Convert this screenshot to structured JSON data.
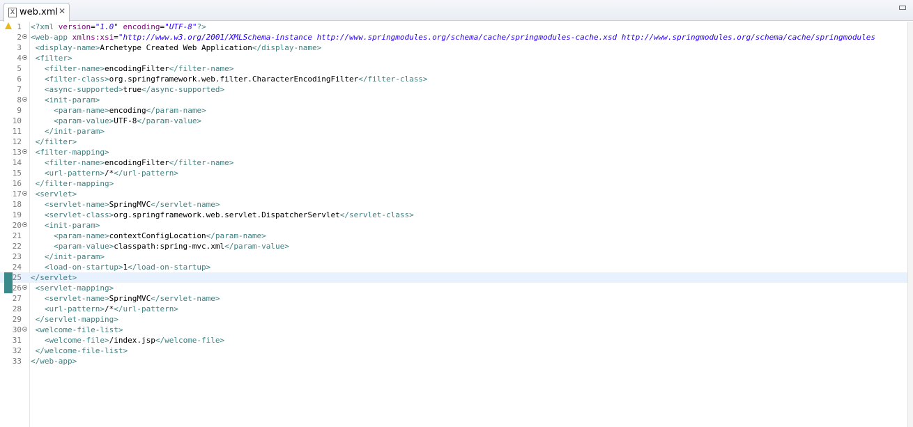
{
  "tab": {
    "label": "web.xml",
    "icon_glyph": "X"
  },
  "lines": [
    {
      "n": "1",
      "fold": false,
      "segs": [
        [
          "t",
          "<?xml "
        ],
        [
          "a",
          "version"
        ],
        [
          "",
          "="
        ],
        [
          "v",
          "\"1.0\""
        ],
        [
          "",
          " "
        ],
        [
          "a",
          "encoding"
        ],
        [
          "",
          "="
        ],
        [
          "v",
          "\"UTF-8\""
        ],
        [
          "t",
          "?>"
        ]
      ]
    },
    {
      "n": "2",
      "fold": true,
      "segs": [
        [
          "t",
          "<web-app "
        ],
        [
          "a",
          "xmlns:xsi"
        ],
        [
          "",
          "="
        ],
        [
          "v",
          "\"http://www.w3.org/2001/XMLSchema-instance http://www.springmodules.org/schema/cache/springmodules-cache.xsd http://www.springmodules.org/schema/cache/springmodules"
        ]
      ]
    },
    {
      "n": "3",
      "fold": false,
      "segs": [
        [
          "",
          " "
        ],
        [
          "t",
          "<display-name>"
        ],
        [
          "",
          "Archetype Created Web Application"
        ],
        [
          "t",
          "</display-name>"
        ]
      ]
    },
    {
      "n": "4",
      "fold": true,
      "segs": [
        [
          "",
          " "
        ],
        [
          "t",
          "<filter>"
        ]
      ]
    },
    {
      "n": "5",
      "fold": false,
      "segs": [
        [
          "",
          "   "
        ],
        [
          "t",
          "<filter-name>"
        ],
        [
          "",
          "encodingFilter"
        ],
        [
          "t",
          "</filter-name>"
        ]
      ]
    },
    {
      "n": "6",
      "fold": false,
      "segs": [
        [
          "",
          "   "
        ],
        [
          "t",
          "<filter-class>"
        ],
        [
          "",
          "org.springframework.web.filter.CharacterEncodingFilter"
        ],
        [
          "t",
          "</filter-class>"
        ]
      ]
    },
    {
      "n": "7",
      "fold": false,
      "segs": [
        [
          "",
          "   "
        ],
        [
          "t",
          "<async-supported>"
        ],
        [
          "",
          "true"
        ],
        [
          "t",
          "</async-supported>"
        ]
      ]
    },
    {
      "n": "8",
      "fold": true,
      "segs": [
        [
          "",
          "   "
        ],
        [
          "t",
          "<init-param>"
        ]
      ]
    },
    {
      "n": "9",
      "fold": false,
      "segs": [
        [
          "",
          "     "
        ],
        [
          "t",
          "<param-name>"
        ],
        [
          "",
          "encoding"
        ],
        [
          "t",
          "</param-name>"
        ]
      ]
    },
    {
      "n": "10",
      "fold": false,
      "segs": [
        [
          "",
          "     "
        ],
        [
          "t",
          "<param-value>"
        ],
        [
          "",
          "UTF-8"
        ],
        [
          "t",
          "</param-value>"
        ]
      ]
    },
    {
      "n": "11",
      "fold": false,
      "segs": [
        [
          "",
          "   "
        ],
        [
          "t",
          "</init-param>"
        ]
      ]
    },
    {
      "n": "12",
      "fold": false,
      "segs": [
        [
          "",
          " "
        ],
        [
          "t",
          "</filter>"
        ]
      ]
    },
    {
      "n": "13",
      "fold": true,
      "segs": [
        [
          "",
          " "
        ],
        [
          "t",
          "<filter-mapping>"
        ]
      ]
    },
    {
      "n": "14",
      "fold": false,
      "segs": [
        [
          "",
          "   "
        ],
        [
          "t",
          "<filter-name>"
        ],
        [
          "",
          "encodingFilter"
        ],
        [
          "t",
          "</filter-name>"
        ]
      ]
    },
    {
      "n": "15",
      "fold": false,
      "segs": [
        [
          "",
          "   "
        ],
        [
          "t",
          "<url-pattern>"
        ],
        [
          "",
          "/*"
        ],
        [
          "t",
          "</url-pattern>"
        ]
      ]
    },
    {
      "n": "16",
      "fold": false,
      "segs": [
        [
          "",
          " "
        ],
        [
          "t",
          "</filter-mapping>"
        ]
      ]
    },
    {
      "n": "17",
      "fold": true,
      "segs": [
        [
          "",
          " "
        ],
        [
          "t",
          "<servlet>"
        ]
      ]
    },
    {
      "n": "18",
      "fold": false,
      "segs": [
        [
          "",
          "   "
        ],
        [
          "t",
          "<servlet-name>"
        ],
        [
          "",
          "SpringMVC"
        ],
        [
          "t",
          "</servlet-name>"
        ]
      ]
    },
    {
      "n": "19",
      "fold": false,
      "segs": [
        [
          "",
          "   "
        ],
        [
          "t",
          "<servlet-class>"
        ],
        [
          "",
          "org.springframework.web.servlet.DispatcherServlet"
        ],
        [
          "t",
          "</servlet-class>"
        ]
      ]
    },
    {
      "n": "20",
      "fold": true,
      "segs": [
        [
          "",
          "   "
        ],
        [
          "t",
          "<init-param>"
        ]
      ]
    },
    {
      "n": "21",
      "fold": false,
      "segs": [
        [
          "",
          "     "
        ],
        [
          "t",
          "<param-name>"
        ],
        [
          "",
          "contextConfigLocation"
        ],
        [
          "t",
          "</param-name>"
        ]
      ]
    },
    {
      "n": "22",
      "fold": false,
      "segs": [
        [
          "",
          "     "
        ],
        [
          "t",
          "<param-value>"
        ],
        [
          "",
          "classpath:spring-mvc.xml"
        ],
        [
          "t",
          "</param-value>"
        ]
      ]
    },
    {
      "n": "23",
      "fold": false,
      "segs": [
        [
          "",
          "   "
        ],
        [
          "t",
          "</init-param>"
        ]
      ]
    },
    {
      "n": "24",
      "fold": false,
      "segs": [
        [
          "",
          "   "
        ],
        [
          "t",
          "<load-on-startup>"
        ],
        [
          "",
          "1"
        ],
        [
          "t",
          "</load-on-startup>"
        ]
      ]
    },
    {
      "n": "25",
      "fold": false,
      "current": true,
      "changed": true,
      "segs": [
        [
          "t",
          "</servlet>"
        ]
      ]
    },
    {
      "n": "26",
      "fold": true,
      "changed": true,
      "segs": [
        [
          "",
          " "
        ],
        [
          "t",
          "<servlet-mapping>"
        ]
      ]
    },
    {
      "n": "27",
      "fold": false,
      "segs": [
        [
          "",
          "   "
        ],
        [
          "t",
          "<servlet-name>"
        ],
        [
          "",
          "SpringMVC"
        ],
        [
          "t",
          "</servlet-name>"
        ]
      ]
    },
    {
      "n": "28",
      "fold": false,
      "segs": [
        [
          "",
          "   "
        ],
        [
          "t",
          "<url-pattern>"
        ],
        [
          "",
          "/*"
        ],
        [
          "t",
          "</url-pattern>"
        ]
      ]
    },
    {
      "n": "29",
      "fold": false,
      "segs": [
        [
          "",
          " "
        ],
        [
          "t",
          "</servlet-mapping>"
        ]
      ]
    },
    {
      "n": "30",
      "fold": true,
      "segs": [
        [
          "",
          " "
        ],
        [
          "t",
          "<welcome-file-list>"
        ]
      ]
    },
    {
      "n": "31",
      "fold": false,
      "segs": [
        [
          "",
          "   "
        ],
        [
          "t",
          "<welcome-file>"
        ],
        [
          "",
          "/index.jsp"
        ],
        [
          "t",
          "</welcome-file>"
        ]
      ]
    },
    {
      "n": "32",
      "fold": false,
      "segs": [
        [
          "",
          " "
        ],
        [
          "t",
          "</welcome-file-list>"
        ]
      ]
    },
    {
      "n": "33",
      "fold": false,
      "segs": [
        [
          "t",
          "</web-app>"
        ]
      ]
    }
  ]
}
